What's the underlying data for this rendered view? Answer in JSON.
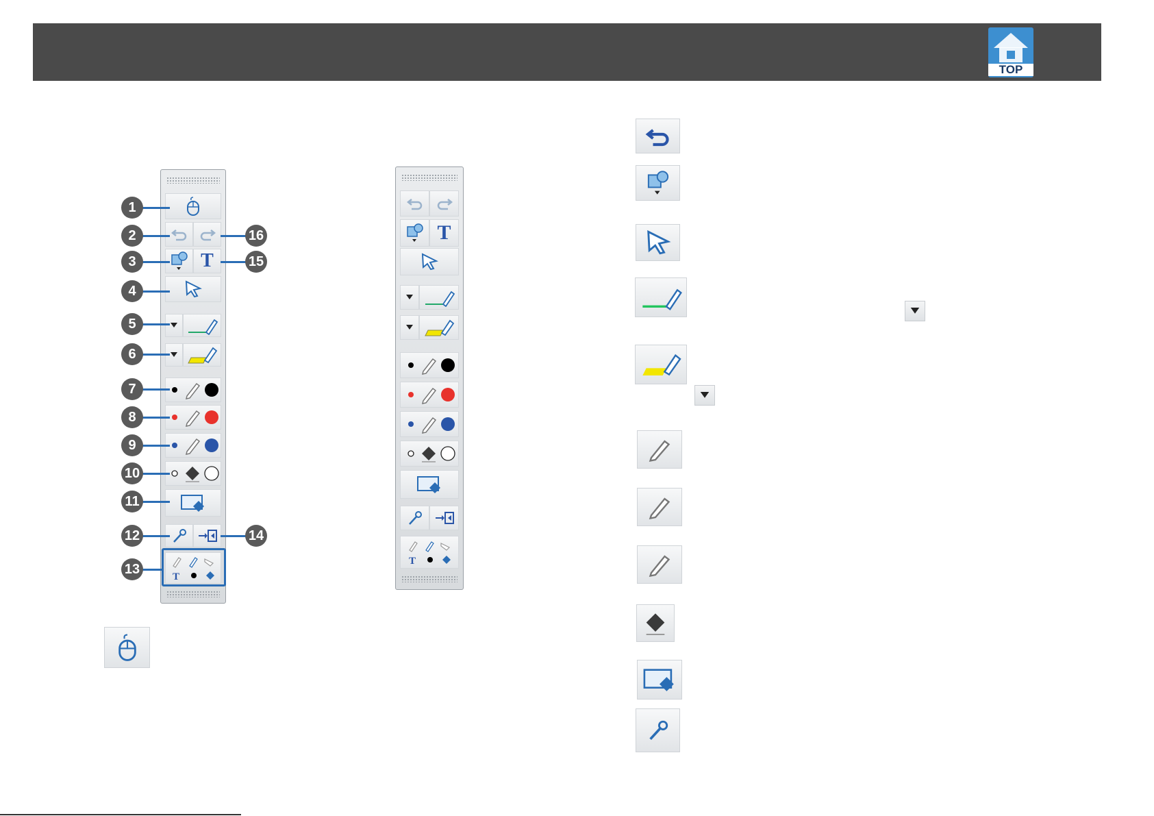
{
  "header": {
    "top_label": "TOP"
  },
  "callouts": [
    "1",
    "2",
    "3",
    "4",
    "5",
    "6",
    "7",
    "8",
    "9",
    "10",
    "11",
    "12",
    "13",
    "14",
    "15",
    "16"
  ],
  "icons": {
    "mouse": "mouse-icon",
    "undo": "undo-icon",
    "redo": "redo-icon",
    "shape": "shape-icon",
    "text": "text-tool-icon",
    "select": "select-arrow-icon",
    "pen": "pen-icon",
    "highlighter": "highlighter-icon",
    "eraser": "eraser-icon",
    "clear_screen": "clear-screen-icon",
    "settings": "settings-wand-icon",
    "dock": "dock-toolbar-icon",
    "dropdown": "dropdown-arrow-icon"
  },
  "colors": {
    "header_bg": "#4a4a4a",
    "accent_blue": "#2a6db5",
    "pen_black": "#000000",
    "pen_red": "#e8322c",
    "pen_blue": "#2a55a8",
    "highlighter_yellow": "#f2e600",
    "pen_green": "#22c55e"
  },
  "text_tool_glyph": "T"
}
